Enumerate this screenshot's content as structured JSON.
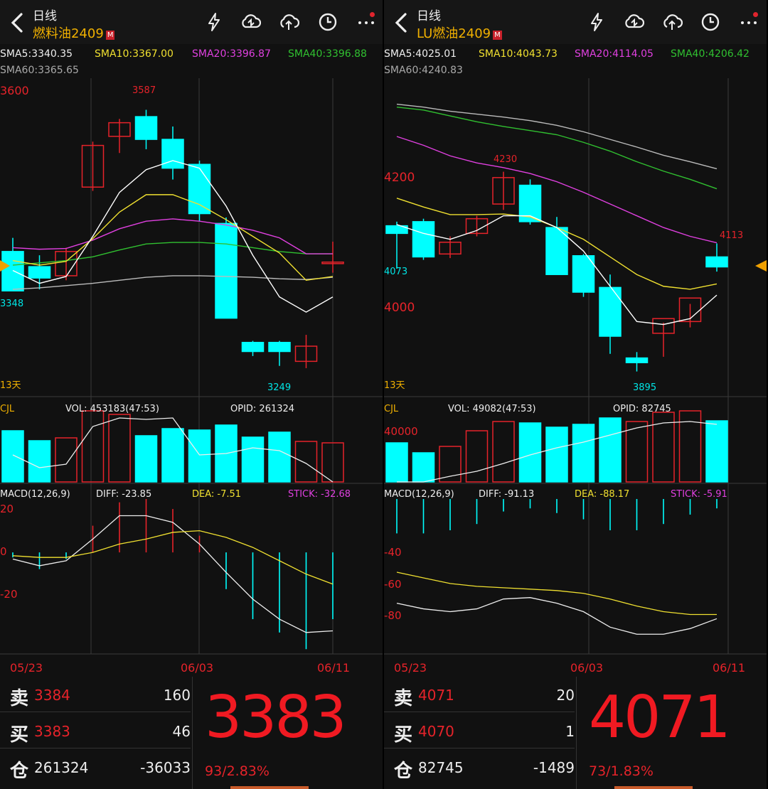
{
  "colors": {
    "up": "#e6232a",
    "down": "#00ffff",
    "sma5": "#ffffff",
    "sma10": "#f0e030",
    "sma20": "#e040e0",
    "sma40": "#30c030",
    "sma60": "#bbbbbb"
  },
  "icons": [
    "back-arrow-icon",
    "lightning-icon",
    "cloud-sync-icon",
    "cloud-upload-icon",
    "clock-icon",
    "more-icon"
  ],
  "panels": [
    {
      "period": "日线",
      "symbol": "燃料油2409",
      "badge": "M",
      "sma": {
        "sma5": "SMA5:3340.35",
        "sma10": "SMA10:3367.00",
        "sma20": "SMA20:3396.87",
        "sma40": "SMA40:3396.88",
        "sma60": "SMA60:3365.65"
      },
      "labels": {
        "top_price": "3600",
        "high_marker": "3587",
        "low_left": "3348",
        "low_marker": "3249",
        "days": "13天"
      },
      "vol": {
        "name": "CJL",
        "vol": "VOL: 453183(47:53)",
        "opid": "OPID: 261324"
      },
      "macd": {
        "name": "MACD(12,26,9)",
        "diff": "DIFF: -23.85",
        "dea": "DEA: -7.51",
        "stick": "STICK: -32.68",
        "ticks": [
          "20",
          "0",
          "-20"
        ]
      },
      "dates": [
        "05/23",
        "06/03",
        "06/11"
      ],
      "quote": {
        "sell_label": "卖",
        "sell_price": "3384",
        "sell_vol": "160",
        "buy_label": "买",
        "buy_price": "3383",
        "buy_vol": "46",
        "oi_label": "仓",
        "oi": "261324",
        "oi_change": "-36033",
        "last": "3383",
        "change": "93/2.83%"
      },
      "chart_data": {
        "type": "candlestick",
        "y_price_range": [
          3230,
          3610
        ],
        "candles": [
          {
            "o": 3400,
            "h": 3418,
            "l": 3348,
            "c": 3348
          },
          {
            "o": 3380,
            "h": 3395,
            "l": 3350,
            "c": 3365
          },
          {
            "o": 3368,
            "h": 3405,
            "l": 3362,
            "c": 3400
          },
          {
            "o": 3485,
            "h": 3545,
            "l": 3480,
            "c": 3540
          },
          {
            "o": 3552,
            "h": 3575,
            "l": 3530,
            "c": 3570
          },
          {
            "o": 3578,
            "h": 3587,
            "l": 3535,
            "c": 3548
          },
          {
            "o": 3548,
            "h": 3565,
            "l": 3495,
            "c": 3510
          },
          {
            "o": 3515,
            "h": 3520,
            "l": 3440,
            "c": 3450
          },
          {
            "o": 3437,
            "h": 3445,
            "l": 3312,
            "c": 3312
          },
          {
            "o": 3280,
            "h": 3282,
            "l": 3262,
            "c": 3268
          },
          {
            "o": 3280,
            "h": 3282,
            "l": 3249,
            "c": 3268
          },
          {
            "o": 3255,
            "h": 3290,
            "l": 3246,
            "c": 3275
          },
          {
            "o": 3384,
            "h": 3413,
            "l": 3372,
            "c": 3386
          }
        ],
        "sma5": [
          3375,
          3358,
          3367,
          3420,
          3478,
          3508,
          3520,
          3510,
          3460,
          3395,
          3340,
          3320,
          3340
        ],
        "sma10": [
          3388,
          3382,
          3387,
          3417,
          3452,
          3475,
          3475,
          3462,
          3442,
          3420,
          3398,
          3362,
          3367
        ],
        "sma20": [
          3405,
          3403,
          3404,
          3415,
          3430,
          3440,
          3443,
          3440,
          3435,
          3428,
          3418,
          3397,
          3397
        ],
        "sma40": [
          3382,
          3385,
          3388,
          3393,
          3402,
          3410,
          3412,
          3412,
          3410,
          3405,
          3400,
          3397,
          3397
        ],
        "sma60": [
          3350,
          3352,
          3355,
          3358,
          3362,
          3366,
          3368,
          3368,
          3367,
          3366,
          3364,
          3363,
          3366
        ],
        "volume": [
          {
            "v": 0.72,
            "up": false
          },
          {
            "v": 0.58,
            "up": false
          },
          {
            "v": 0.62,
            "up": true
          },
          {
            "v": 1.0,
            "up": true
          },
          {
            "v": 0.95,
            "up": true
          },
          {
            "v": 0.65,
            "up": false
          },
          {
            "v": 0.75,
            "up": false
          },
          {
            "v": 0.73,
            "up": false
          },
          {
            "v": 0.8,
            "up": false
          },
          {
            "v": 0.63,
            "up": false
          },
          {
            "v": 0.7,
            "up": false
          },
          {
            "v": 0.57,
            "up": true
          },
          {
            "v": 0.55,
            "up": true
          }
        ],
        "vol_ma": [
          0.38,
          0.2,
          0.25,
          0.78,
          0.9,
          0.88,
          0.9,
          0.38,
          0.4,
          0.48,
          0.44,
          0.26,
          0.0
        ],
        "macd_range": [
          -60,
          32
        ],
        "diff": [
          -4,
          -8,
          -5,
          8,
          22,
          22,
          18,
          5,
          -12,
          -28,
          -40,
          -48,
          -47
        ],
        "dea": [
          -2,
          -3,
          -3,
          0,
          5,
          8,
          12,
          13,
          9,
          3,
          -5,
          -13,
          -19
        ],
        "stick": [
          -3,
          -10,
          -4,
          16,
          30,
          32,
          26,
          10,
          -22,
          -40,
          -48,
          -58,
          -40
        ]
      }
    },
    {
      "period": "日线",
      "symbol": "LU燃油2409",
      "badge": "M",
      "sma": {
        "sma5": "SMA5:4025.01",
        "sma10": "SMA10:4043.73",
        "sma20": "SMA20:4114.05",
        "sma40": "SMA40:4206.42",
        "sma60": "SMA60:4240.83"
      },
      "labels": {
        "top_price": "4200",
        "bottom_price": "4000",
        "high_marker": "4230",
        "right_marker": "4113",
        "low_left": "4073",
        "low_marker": "3895",
        "days": "13天"
      },
      "vol": {
        "name": "CJL",
        "vol": "VOL: 49082(47:53)",
        "opid": "OPID: 82745",
        "tick": "40000"
      },
      "macd": {
        "name": "MACD(12,26,9)",
        "diff": "DIFF: -91.13",
        "dea": "DEA: -88.17",
        "stick": "STICK: -5.91",
        "ticks": [
          "-40",
          "-60",
          "-80"
        ]
      },
      "dates": [
        "05/23",
        "06/03",
        "06/11"
      ],
      "quote": {
        "sell_label": "卖",
        "sell_price": "4071",
        "sell_vol": "20",
        "buy_label": "买",
        "buy_price": "4070",
        "buy_vol": "1",
        "oi_label": "仓",
        "oi": "82745",
        "oi_change": "-1489",
        "last": "4071",
        "change": "73/1.83%"
      },
      "chart_data": {
        "type": "candlestick",
        "y_price_range": [
          3880,
          4370
        ],
        "candles": [
          {
            "o": 4143,
            "h": 4150,
            "l": 4070,
            "c": 4130
          },
          {
            "o": 4150,
            "h": 4155,
            "l": 4085,
            "c": 4090
          },
          {
            "o": 4095,
            "h": 4125,
            "l": 4088,
            "c": 4115
          },
          {
            "o": 4130,
            "h": 4160,
            "l": 4125,
            "c": 4155
          },
          {
            "o": 4180,
            "h": 4235,
            "l": 4170,
            "c": 4225
          },
          {
            "o": 4212,
            "h": 4222,
            "l": 4145,
            "c": 4150
          },
          {
            "o": 4140,
            "h": 4158,
            "l": 4060,
            "c": 4060
          },
          {
            "o": 4092,
            "h": 4095,
            "l": 4022,
            "c": 4030
          },
          {
            "o": 4038,
            "h": 4060,
            "l": 3925,
            "c": 3955
          },
          {
            "o": 3918,
            "h": 3928,
            "l": 3895,
            "c": 3910
          },
          {
            "o": 3960,
            "h": 3978,
            "l": 3920,
            "c": 3985
          },
          {
            "o": 3980,
            "h": 4010,
            "l": 3970,
            "c": 4020
          },
          {
            "o": 4090,
            "h": 4113,
            "l": 4065,
            "c": 4073
          }
        ],
        "sma5": [
          4145,
          4130,
          4120,
          4135,
          4160,
          4160,
          4140,
          4100,
          4040,
          3980,
          3975,
          3985,
          4025
        ],
        "sma10": [
          4190,
          4175,
          4162,
          4162,
          4163,
          4158,
          4140,
          4120,
          4090,
          4060,
          4040,
          4035,
          4044
        ],
        "sma20": [
          4295,
          4280,
          4262,
          4250,
          4242,
          4232,
          4218,
          4200,
          4180,
          4160,
          4140,
          4125,
          4114
        ],
        "sma40": [
          4345,
          4340,
          4330,
          4320,
          4312,
          4305,
          4298,
          4285,
          4270,
          4252,
          4236,
          4222,
          4206
        ],
        "sma60": [
          4350,
          4345,
          4338,
          4333,
          4328,
          4322,
          4314,
          4303,
          4290,
          4277,
          4263,
          4252,
          4240
        ],
        "volume": [
          {
            "v": 0.55,
            "up": false
          },
          {
            "v": 0.41,
            "up": false
          },
          {
            "v": 0.5,
            "up": true
          },
          {
            "v": 0.72,
            "up": true
          },
          {
            "v": 0.85,
            "up": true
          },
          {
            "v": 0.83,
            "up": false
          },
          {
            "v": 0.77,
            "up": false
          },
          {
            "v": 0.81,
            "up": false
          },
          {
            "v": 0.9,
            "up": false
          },
          {
            "v": 0.85,
            "up": true
          },
          {
            "v": 0.98,
            "up": true
          },
          {
            "v": 1.0,
            "up": true
          },
          {
            "v": 0.86,
            "up": false
          }
        ],
        "vol_ma": [
          0.0,
          0.0,
          0.08,
          0.15,
          0.26,
          0.38,
          0.48,
          0.56,
          0.66,
          0.76,
          0.83,
          0.85,
          0.81
        ],
        "macd_range": [
          -115,
          -6
        ],
        "diff": [
          -80,
          -84,
          -86,
          -84,
          -77,
          -76,
          -80,
          -86,
          -97,
          -102,
          -102,
          -98,
          -91
        ],
        "dea": [
          -58,
          -62,
          -66,
          -68,
          -69,
          -70,
          -71,
          -73,
          -77,
          -82,
          -86,
          -88,
          -88
        ],
        "stick": [
          -22,
          -22,
          -20,
          -16,
          -8,
          -6,
          -9,
          -13,
          -20,
          -20,
          -16,
          -10,
          -6
        ]
      }
    }
  ]
}
